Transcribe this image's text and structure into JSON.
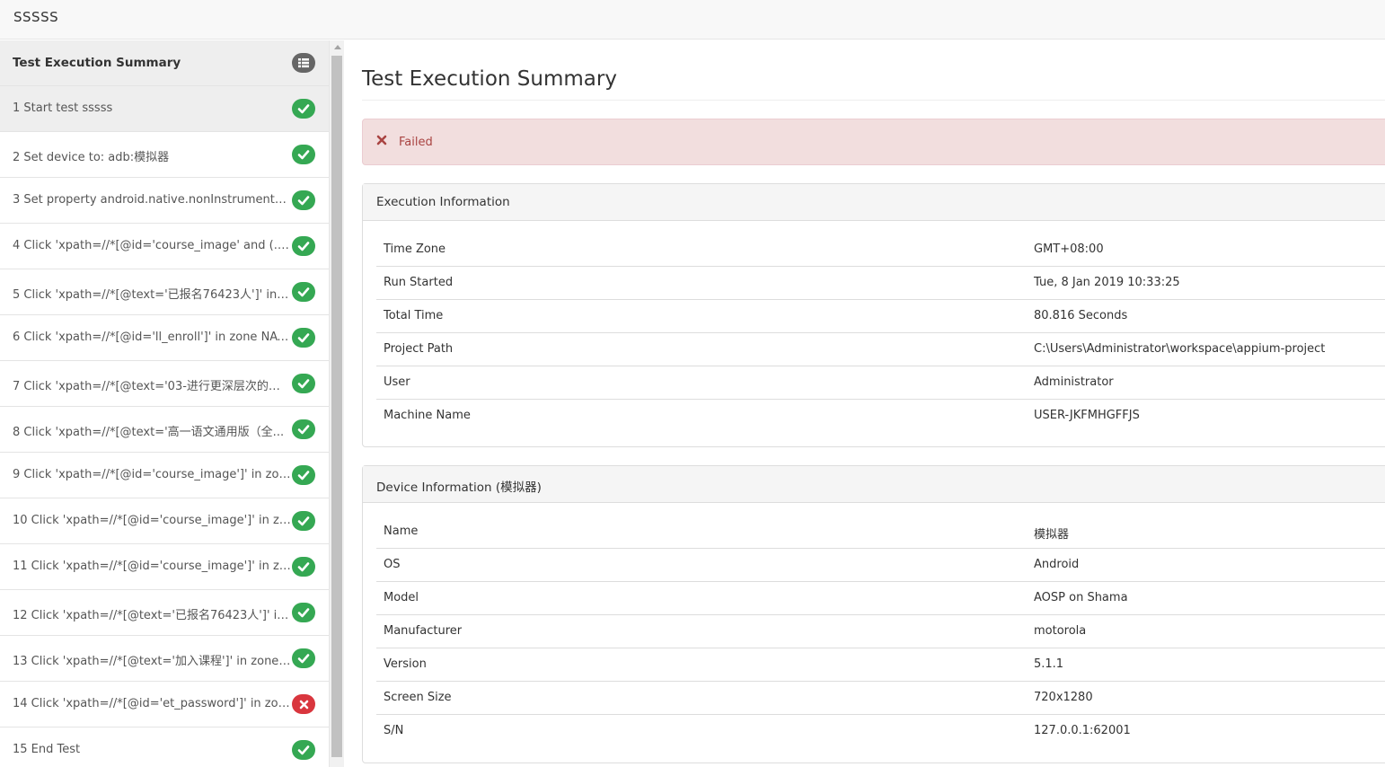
{
  "app": {
    "brand": "SSSSS"
  },
  "sidebar": {
    "items": [
      {
        "label": "Test Execution Summary",
        "status": "list",
        "header": true
      },
      {
        "label": "1 Start test sssss",
        "status": "pass",
        "active": true
      },
      {
        "label": "2 Set device to: adb:模拟器",
        "status": "pass"
      },
      {
        "label": "3 Set property android.native.nonInstrumented ...",
        "status": "pass"
      },
      {
        "label": "4 Click 'xpath=//*[@id='course_image' and (./pre...",
        "status": "pass"
      },
      {
        "label": "5 Click 'xpath=//*[@text='已报名76423人']' in z...",
        "status": "pass"
      },
      {
        "label": "6 Click 'xpath=//*[@id='ll_enroll']' in zone NATIV...",
        "status": "pass"
      },
      {
        "label": "7 Click 'xpath=//*[@text='03-进行更深层次的阅...",
        "status": "pass"
      },
      {
        "label": "8 Click 'xpath=//*[@text='高一语文通用版（全...",
        "status": "pass"
      },
      {
        "label": "9 Click 'xpath=//*[@id='course_image']' in zone ...",
        "status": "pass"
      },
      {
        "label": "10 Click 'xpath=//*[@id='course_image']' in zone...",
        "status": "pass"
      },
      {
        "label": "11 Click 'xpath=//*[@id='course_image']' in zone...",
        "status": "pass"
      },
      {
        "label": "12 Click 'xpath=//*[@text='已报名76423人']' in ...",
        "status": "pass"
      },
      {
        "label": "13 Click 'xpath=//*[@text='加入课程']' in zone N...",
        "status": "pass"
      },
      {
        "label": "14 Click 'xpath=//*[@id='et_password']' in zone ...",
        "status": "fail"
      },
      {
        "label": "15 End Test",
        "status": "pass"
      }
    ]
  },
  "main": {
    "title": "Test Execution Summary",
    "alert": {
      "text": "Failed",
      "icon": "close-icon"
    },
    "execution_panel": {
      "title": "Execution Information",
      "rows": [
        {
          "key": "Time Zone",
          "value": "GMT+08:00"
        },
        {
          "key": "Run Started",
          "value": "Tue, 8 Jan 2019 10:33:25"
        },
        {
          "key": "Total Time",
          "value": "80.816 Seconds"
        },
        {
          "key": "Project Path",
          "value": "C:\\Users\\Administrator\\workspace\\appium-project"
        },
        {
          "key": "User",
          "value": "Administrator"
        },
        {
          "key": "Machine Name",
          "value": "USER-JKFMHGFFJS"
        }
      ]
    },
    "device_panel": {
      "title": "Device Information (模拟器)",
      "rows": [
        {
          "key": "Name",
          "value": "模拟器"
        },
        {
          "key": "OS",
          "value": "Android"
        },
        {
          "key": "Model",
          "value": "AOSP on Shama"
        },
        {
          "key": "Manufacturer",
          "value": "motorola"
        },
        {
          "key": "Version",
          "value": "5.1.1"
        },
        {
          "key": "Screen Size",
          "value": "720x1280"
        },
        {
          "key": "S/N",
          "value": "127.0.0.1:62001"
        }
      ]
    }
  },
  "colors": {
    "pass": "#35a853",
    "fail": "#d9363e",
    "list": "#666666",
    "alert_bg": "#f2dede",
    "alert_text": "#a94442"
  }
}
